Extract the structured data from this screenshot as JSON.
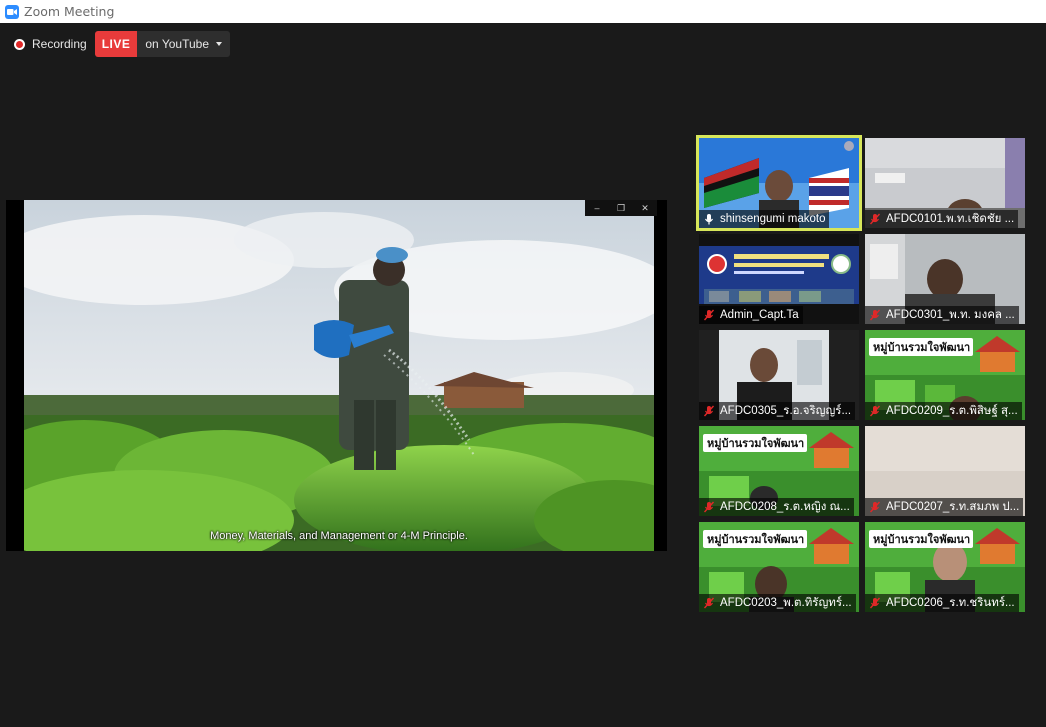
{
  "window": {
    "title": "Zoom Meeting"
  },
  "recording": {
    "label": "Recording"
  },
  "live": {
    "badge": "LIVE",
    "destination": "on YouTube"
  },
  "shared_video": {
    "subtitle": "Money, Materials, and Management or 4-M Principle.",
    "controls": {
      "minimize": "–",
      "restore": "❐",
      "close": "✕"
    }
  },
  "banner_text": "หมู่บ้านรวมใจพัฒนา",
  "participants": [
    {
      "name": "shinsengumi makoto",
      "muted": false,
      "active": true
    },
    {
      "name": "AFDC0101.พ.ท.เชิดชัย ...",
      "muted": true,
      "active": false
    },
    {
      "name": "Admin_Capt.Ta",
      "muted": true,
      "active": false
    },
    {
      "name": "AFDC0301_พ.ท. มงคล ...",
      "muted": true,
      "active": false
    },
    {
      "name": "AFDC0305_ร.อ.จริญญร์...",
      "muted": true,
      "active": false
    },
    {
      "name": "AFDC0209_ร.ต.พิสิษฐ์ สุ...",
      "muted": true,
      "active": false
    },
    {
      "name": "AFDC0208_ร.ต.หญิง ณ...",
      "muted": true,
      "active": false
    },
    {
      "name": "AFDC0207_ร.ท.สมภพ ป...",
      "muted": true,
      "active": false
    },
    {
      "name": "AFDC0203_พ.ต.ทิรัญทร์...",
      "muted": true,
      "active": false
    },
    {
      "name": "AFDC0206_ร.ท.ชรินทร์...",
      "muted": true,
      "active": false
    }
  ],
  "colors": {
    "live": "#e83b3b",
    "active_border": "#d7e65a",
    "muted_mic": "#e02828",
    "zoom_blue": "#2d8cff"
  }
}
